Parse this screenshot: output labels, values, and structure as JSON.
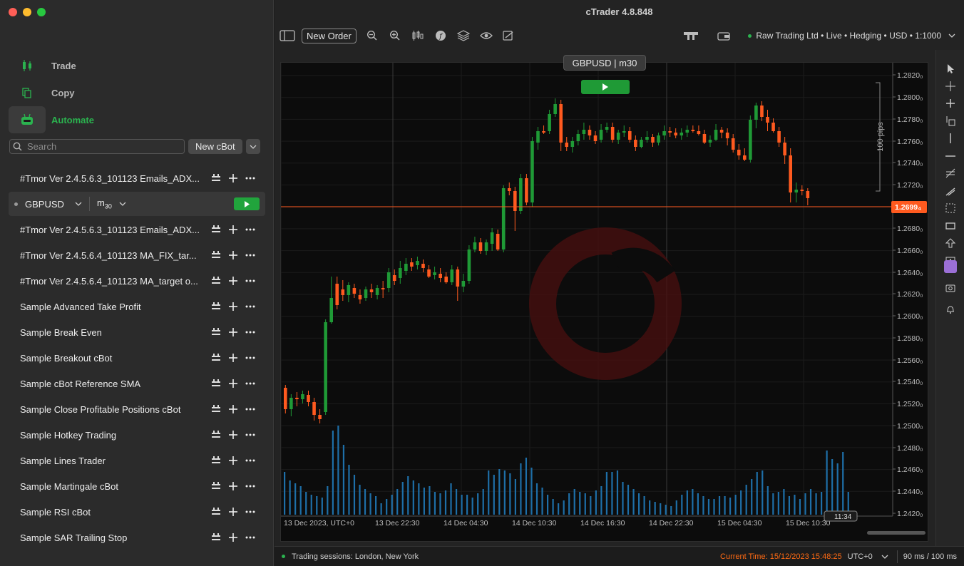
{
  "window": {
    "title": "cTrader 4.8.848"
  },
  "sidebar": {
    "nav": [
      {
        "label": "Trade",
        "icon": "candles-icon"
      },
      {
        "label": "Copy",
        "icon": "copy-icon"
      },
      {
        "label": "Automate",
        "icon": "robot-icon",
        "active": true
      }
    ],
    "search": {
      "placeholder": "Search"
    },
    "new_cbot_label": "New cBot",
    "bots": [
      {
        "name": "#Tmor Ver 2.4.5.6.3_101123 Emails_ADX..."
      },
      {
        "name": "#Tmor Ver 2.4.5.6.3_101123 Emails_ADX..."
      },
      {
        "name": "#Tmor Ver 2.4.5.6.4_101123 MA_FIX_tar..."
      },
      {
        "name": "#Tmor Ver 2.4.5.6.4_101123 MA_target o..."
      },
      {
        "name": "Sample Advanced Take Profit"
      },
      {
        "name": "Sample Break Even"
      },
      {
        "name": "Sample Breakout cBot"
      },
      {
        "name": "Sample cBot Reference SMA"
      },
      {
        "name": "Sample Close Profitable Positions cBot"
      },
      {
        "name": "Sample Hotkey Trading"
      },
      {
        "name": "Sample Lines Trader"
      },
      {
        "name": "Sample Martingale cBot"
      },
      {
        "name": "Sample RSI cBot"
      },
      {
        "name": "Sample SAR Trailing Stop"
      }
    ],
    "instance": {
      "symbol": "GBPUSD",
      "timeframe_main": "m",
      "timeframe_sub": "30"
    }
  },
  "toolbar": {
    "new_order_label": "New Order",
    "account": "Raw Trading Ltd • Live • Hedging • USD • 1:1000"
  },
  "chart": {
    "tag": "GBPUSD | m30",
    "pips_label": "100 pips",
    "current_price": "1.2699₄",
    "y_labels": [
      "1.2820₀",
      "1.2800₀",
      "1.2780₀",
      "1.2760₀",
      "1.2740₀",
      "1.2720₀",
      "1.2680₀",
      "1.2660₀",
      "1.2640₀",
      "1.2620₀",
      "1.2600₀",
      "1.2580₀",
      "1.2560₀",
      "1.2540₀",
      "1.2520₀",
      "1.2500₀",
      "1.2480₀",
      "1.2460₀",
      "1.2440₀",
      "1.2420₀"
    ],
    "x_labels": [
      "13 Dec 2023, UTC+0",
      "13 Dec 22:30",
      "14 Dec 04:30",
      "14 Dec 10:30",
      "14 Dec 16:30",
      "14 Dec 22:30",
      "15 Dec 04:30",
      "15 Dec 10:30"
    ],
    "cursor_time": "11:34",
    "colors": {
      "up": "#1f9a36",
      "down": "#ff5a1f",
      "volume": "#1e6fa8",
      "price_line": "#ff5a1f"
    }
  },
  "chart_data": {
    "type": "candlestick",
    "symbol": "GBPUSD",
    "timeframe": "m30",
    "current_price": 1.26994,
    "ylim": [
      1.2416,
      1.2822
    ]
  },
  "status": {
    "sessions": "Trading sessions: London, New York",
    "current_time_label": "Current Time: 15/12/2023 15:48:25",
    "timezone": "UTC+0",
    "latency": "90 ms / 100 ms"
  }
}
